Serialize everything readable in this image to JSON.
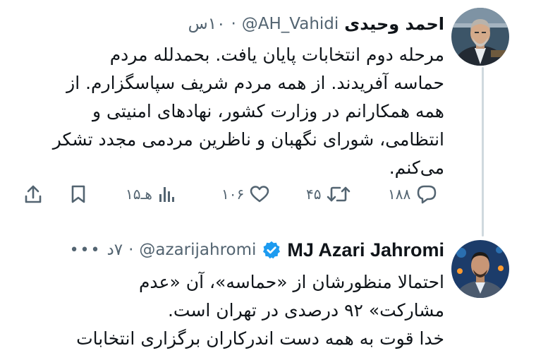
{
  "tweets": [
    {
      "author_name": "احمد وحیدی",
      "handle": "@AH_Vahidi",
      "time": "۱۰س",
      "verified": false,
      "text_lines": [
        "مرحله دوم انتخابات پایان یافت. بحمدلله مردم",
        "حماسه آفریدند. از همه مردم شریف سپاسگزارم. از",
        "همه همکارانم در وزارت کشور، نهادهای امنیتی و",
        "انتظامی، شورای نگهبان و ناظرین مردمی مجدد تشکر",
        "می‌کنم."
      ],
      "stats": {
        "replies": "۱۸۸",
        "retweets": "۴۵",
        "likes": "۱۰۶",
        "views": "۱۵هـ"
      }
    },
    {
      "author_name": "MJ Azari Jahromi",
      "handle": "@azarijahromi",
      "time": "۷د",
      "verified": true,
      "text_lines": [
        "احتمالا منظورشان از «حماسه»، آن «عدم",
        "مشارکت» ۹۲ درصدی در تهران است.",
        "خدا قوت به همه دست اندرکاران برگزاری انتخابات"
      ]
    }
  ],
  "icons": {
    "reply": "reply-icon",
    "retweet": "retweet-icon",
    "like": "heart-icon",
    "views": "analytics-icon",
    "bookmark": "bookmark-icon",
    "share": "share-icon",
    "verified": "verified-badge-icon",
    "more": "more-icon"
  },
  "colors": {
    "text": "#0f1419",
    "secondary": "#536471",
    "verified": "#1d9bf0",
    "thread_line": "#cfd9de"
  }
}
